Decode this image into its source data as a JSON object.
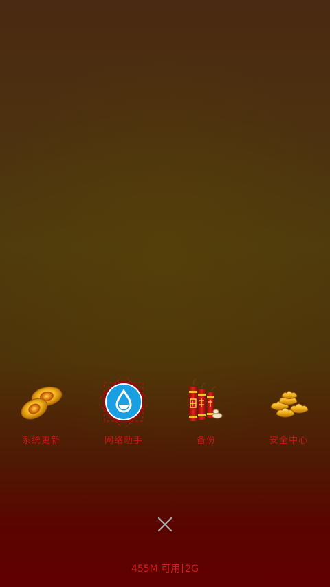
{
  "launcher": {
    "items": [
      {
        "label": "系统更新",
        "icon": "gold-ingots-icon"
      },
      {
        "label": "网络助手",
        "icon": "water-drop-icon"
      },
      {
        "label": "备份",
        "icon": "firecrackers-icon"
      },
      {
        "label": "安全中心",
        "icon": "gold-ingot-pile-icon"
      }
    ]
  },
  "close_button": {
    "icon": "close-icon"
  },
  "memory_status": {
    "available": "455M 可用",
    "total": "2G"
  },
  "colors": {
    "label_red": "#c81616",
    "drop_blue": "#1aa0e2",
    "gold": "#f2b21a",
    "background_top": "#4a2a12",
    "background_bottom": "#600000"
  }
}
